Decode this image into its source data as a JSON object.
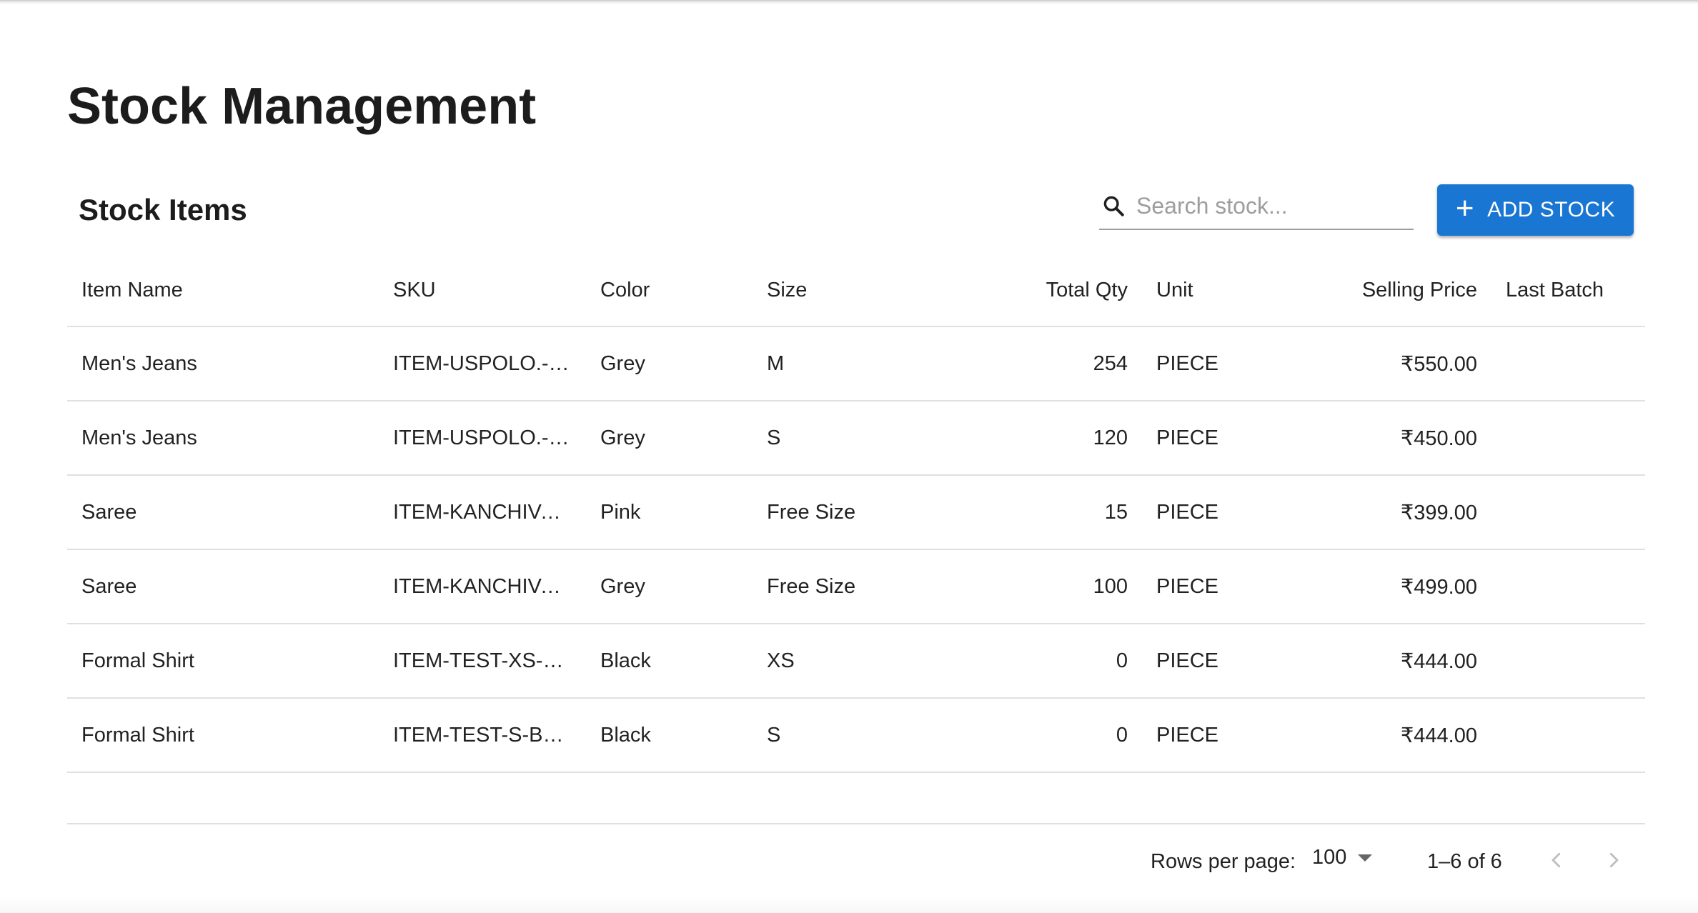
{
  "page": {
    "title": "Stock Management"
  },
  "toolbar": {
    "section_title": "Stock Items",
    "search_placeholder": "Search stock...",
    "add_button_label": "ADD STOCK"
  },
  "table": {
    "columns": [
      "Item Name",
      "SKU",
      "Color",
      "Size",
      "Total Qty",
      "Unit",
      "Selling Price",
      "Last Batch"
    ],
    "rows": [
      {
        "item_name": "Men's Jeans",
        "sku": "ITEM-USPOLO.-…",
        "color": "Grey",
        "size": "M",
        "total_qty": "254",
        "unit": "PIECE",
        "selling_price": "₹550.00",
        "last_batch": ""
      },
      {
        "item_name": "Men's Jeans",
        "sku": "ITEM-USPOLO.-…",
        "color": "Grey",
        "size": "S",
        "total_qty": "120",
        "unit": "PIECE",
        "selling_price": "₹450.00",
        "last_batch": ""
      },
      {
        "item_name": "Saree",
        "sku": "ITEM-KANCHIVA…",
        "color": "Pink",
        "size": "Free Size",
        "total_qty": "15",
        "unit": "PIECE",
        "selling_price": "₹399.00",
        "last_batch": ""
      },
      {
        "item_name": "Saree",
        "sku": "ITEM-KANCHIVA…",
        "color": "Grey",
        "size": "Free Size",
        "total_qty": "100",
        "unit": "PIECE",
        "selling_price": "₹499.00",
        "last_batch": ""
      },
      {
        "item_name": "Formal Shirt",
        "sku": "ITEM-TEST-XS-B…",
        "color": "Black",
        "size": "XS",
        "total_qty": "0",
        "unit": "PIECE",
        "selling_price": "₹444.00",
        "last_batch": ""
      },
      {
        "item_name": "Formal Shirt",
        "sku": "ITEM-TEST-S-BL…",
        "color": "Black",
        "size": "S",
        "total_qty": "0",
        "unit": "PIECE",
        "selling_price": "₹444.00",
        "last_batch": ""
      }
    ]
  },
  "pagination": {
    "rows_per_page_label": "Rows per page:",
    "rows_per_page_value": "100",
    "range_text": "1–6 of 6"
  },
  "icons": {
    "search": "search-icon",
    "add": "plus-icon",
    "dropdown": "caret-down-icon",
    "prev": "chevron-left-icon",
    "next": "chevron-right-icon"
  },
  "colors": {
    "primary": "#1976d2",
    "divider": "#e0e0e0"
  }
}
